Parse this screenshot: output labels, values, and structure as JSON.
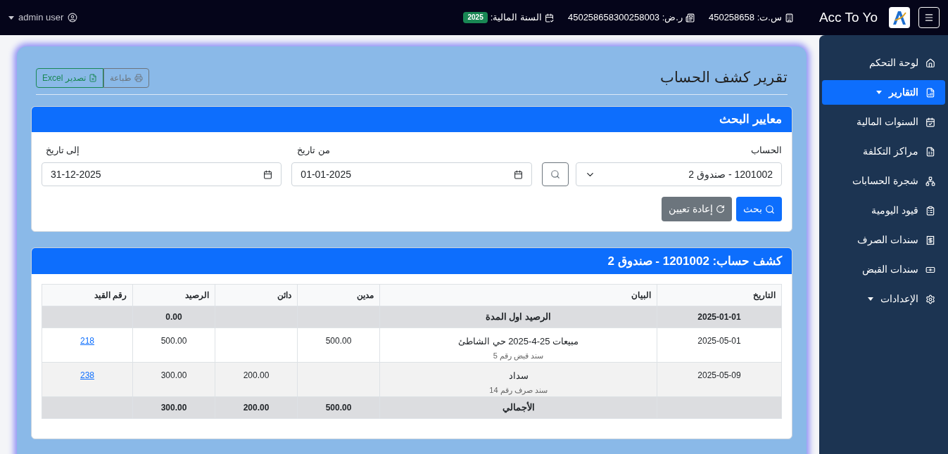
{
  "topbar": {
    "brand": "Acc To Yo",
    "cr": {
      "label": "س.ت:",
      "value": "450258658"
    },
    "tax": {
      "label": "ر.ض:",
      "value": "450258658300258003"
    },
    "fiscal": {
      "label": "السنة المالية:",
      "badge": "2025"
    },
    "user": "admin user"
  },
  "sidebar": {
    "items": [
      {
        "label": "لوحة التحكم",
        "selected": false,
        "has_caret": false
      },
      {
        "label": "التقارير",
        "selected": true,
        "has_caret": true
      },
      {
        "label": "السنوات المالية",
        "selected": false,
        "has_caret": false
      },
      {
        "label": "مراكز التكلفة",
        "selected": false,
        "has_caret": false
      },
      {
        "label": "شجرة الحسابات",
        "selected": false,
        "has_caret": false
      },
      {
        "label": "قيود اليومية",
        "selected": false,
        "has_caret": false
      },
      {
        "label": "سندات الصرف",
        "selected": false,
        "has_caret": false
      },
      {
        "label": "سندات القبض",
        "selected": false,
        "has_caret": false
      },
      {
        "label": "الإعدادات",
        "selected": false,
        "has_caret": true
      }
    ]
  },
  "page": {
    "title": "تقرير كشف الحساب",
    "actions": [
      "طباعة",
      "تصدير Excel"
    ]
  },
  "search": {
    "title": "معايير البحث",
    "account": {
      "label": "الحساب",
      "value": "1201002 - صندوق 2"
    },
    "from": {
      "label": "من تاريخ",
      "value": "01-01-2025"
    },
    "to": {
      "label": "إلى تاريخ",
      "value": "31-12-2025"
    },
    "buttons": [
      "بحث",
      "إعادة تعيين"
    ]
  },
  "statement": {
    "title": "كشف حساب: 1201002 - صندوق 2",
    "columns": [
      "التاريخ",
      "البيان",
      "مدين",
      "دائن",
      "الرصيد",
      "رقم القيد"
    ],
    "rows": [
      {
        "kind": "opening",
        "date": "2025-01-01",
        "description": "الرصيد اول المدة",
        "balance": "0.00"
      },
      {
        "kind": "entry",
        "date": "2025-05-01",
        "description": "مبيعات 25-4-2025 حي الشاطئ",
        "note": "سند قبض رقم 5",
        "debit": "500.00",
        "balance": "500.00",
        "entry_no": "218"
      },
      {
        "kind": "entry",
        "date": "2025-05-09",
        "description": "سداد",
        "note": "سند صرف رقم 14",
        "credit": "200.00",
        "balance": "300.00",
        "entry_no": "238"
      },
      {
        "kind": "total",
        "description": "الأجمالي",
        "debit": "500.00",
        "credit": "200.00",
        "balance": "300.00"
      }
    ]
  }
}
